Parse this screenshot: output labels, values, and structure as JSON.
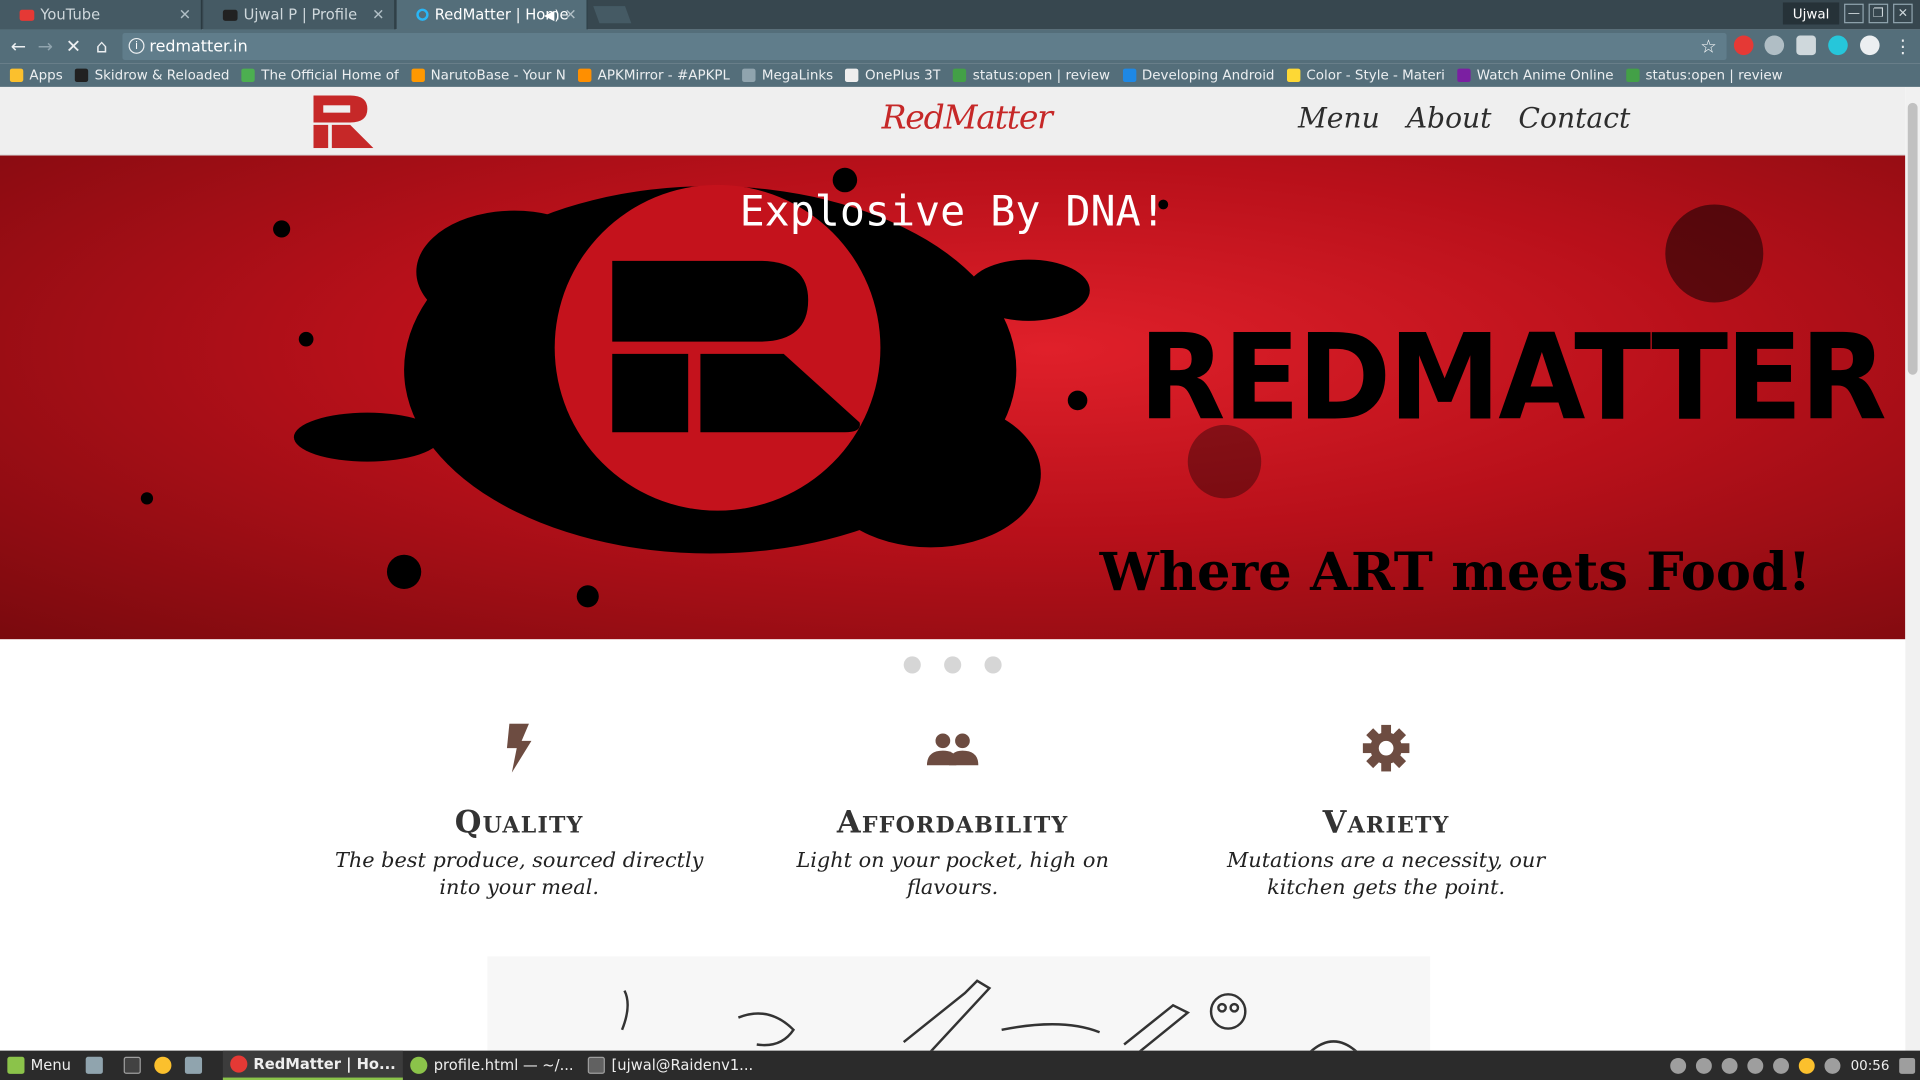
{
  "tabs": [
    {
      "title": "YouTube",
      "favicon_color": "#e53935"
    },
    {
      "title": "Ujwal P | Profile",
      "favicon_color": "#212121"
    },
    {
      "title": "RedMatter | Home",
      "favicon_color": "#29b6f6"
    }
  ],
  "window": {
    "user_label": "Ujwal"
  },
  "address_bar": {
    "url": "redmatter.in"
  },
  "bookmarks": [
    {
      "label": "Apps",
      "color": "#fbc02d"
    },
    {
      "label": "Skidrow & Reloaded",
      "color": "#212121"
    },
    {
      "label": "The Official Home of",
      "color": "#4caf50"
    },
    {
      "label": "NarutoBase - Your N",
      "color": "#ff9800"
    },
    {
      "label": "APKMirror - #APKPL",
      "color": "#ff8f00"
    },
    {
      "label": "MegaLinks",
      "color": "#90a4ae"
    },
    {
      "label": "OnePlus 3T",
      "color": "#eeeeee"
    },
    {
      "label": "status:open | review",
      "color": "#43a047"
    },
    {
      "label": "Developing Android",
      "color": "#1e88e5"
    },
    {
      "label": "Color - Style - Materi",
      "color": "#fdd835"
    },
    {
      "label": "Watch Anime Online",
      "color": "#7b1fa2"
    },
    {
      "label": "status:open | review",
      "color": "#43a047"
    }
  ],
  "site": {
    "brand": "RedMatter",
    "nav": [
      "Menu",
      "About",
      "Contact"
    ],
    "hero": {
      "tagline": "Explosive By DNA!",
      "title": "REDMATTER",
      "subtitle": "Where ART meets Food!"
    },
    "features": [
      {
        "icon": "lightning-icon",
        "title": "Quality",
        "text": "The best produce, sourced directly into your meal."
      },
      {
        "icon": "people-icon",
        "title": "Affordability",
        "text": "Light on your pocket, high on flavours."
      },
      {
        "icon": "gear-icon",
        "title": "Variety",
        "text": "Mutations are a necessity, our kitchen gets the point."
      }
    ],
    "carousel_dots": 3
  },
  "taskbar": {
    "menu_label": "Menu",
    "tasks": [
      {
        "label": "RedMatter | Ho...",
        "color": "#e53935"
      },
      {
        "label": "profile.html — ~/...",
        "color": "#8bc34a"
      },
      {
        "label": "[ujwal@Raidenv1...",
        "color": "#616161"
      }
    ],
    "clock": "00:56"
  },
  "colors": {
    "brand_red": "#c62828",
    "hero_red": "#d81b28",
    "icon_brown": "#6d4c41"
  }
}
